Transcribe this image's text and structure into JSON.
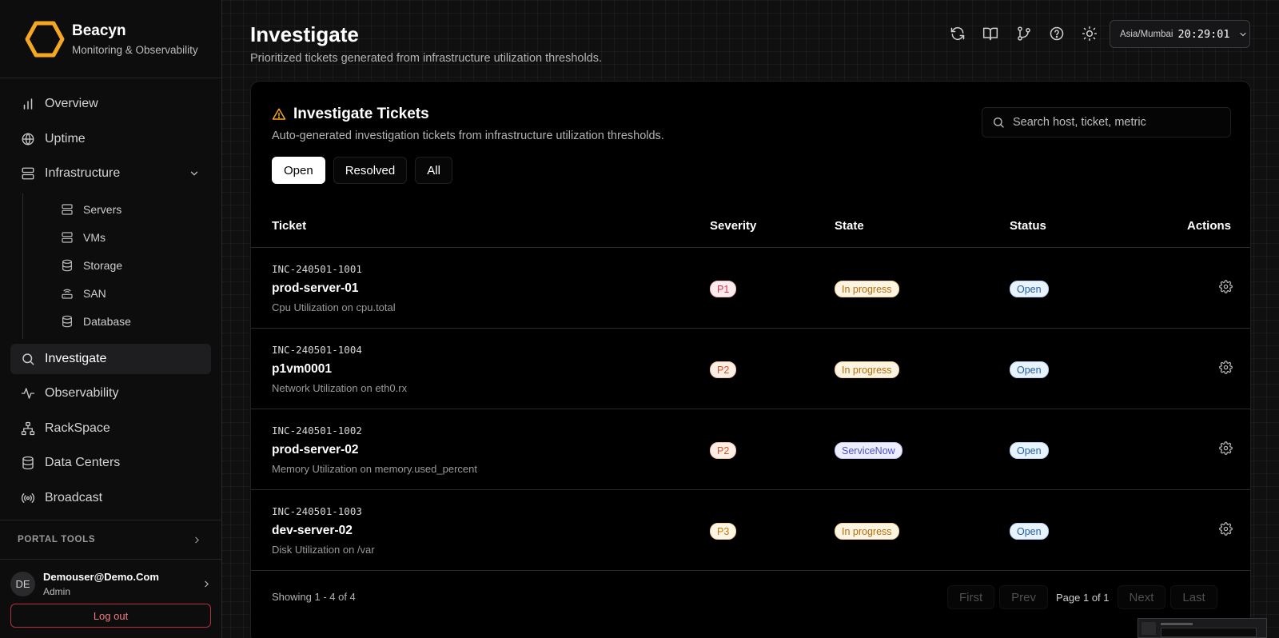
{
  "brand": {
    "name": "Beacyn",
    "tagline": "Monitoring & Observability",
    "logo_color": "#f5a623"
  },
  "sidebar": {
    "items": [
      {
        "label": "Overview",
        "icon": "bar-chart-icon"
      },
      {
        "label": "Uptime",
        "icon": "globe-icon"
      },
      {
        "label": "Infrastructure",
        "icon": "server-icon",
        "expanded": true
      }
    ],
    "infrastructure_children": [
      {
        "label": "Servers",
        "icon": "server-icon"
      },
      {
        "label": "VMs",
        "icon": "server-icon"
      },
      {
        "label": "Storage",
        "icon": "database-icon"
      },
      {
        "label": "SAN",
        "icon": "router-icon"
      },
      {
        "label": "Database",
        "icon": "database-icon"
      }
    ],
    "lower_items": [
      {
        "label": "Investigate",
        "icon": "search-icon",
        "active": true
      },
      {
        "label": "Observability",
        "icon": "activity-icon"
      },
      {
        "label": "RackSpace",
        "icon": "network-icon"
      },
      {
        "label": "Data Centers",
        "icon": "database-icon"
      },
      {
        "label": "Broadcast",
        "icon": "broadcast-icon"
      }
    ],
    "portal_tools": "PORTAL TOOLS",
    "user": {
      "initials": "DE",
      "email": "Demouser@Demo.Com",
      "role": "Admin"
    },
    "logout": "Log out"
  },
  "header": {
    "title": "Investigate",
    "subtitle": "Prioritized tickets generated from infrastructure utilization thresholds.",
    "toolbar_icons": [
      "refresh-icon",
      "book-icon",
      "git-branch-icon",
      "help-icon",
      "sun-icon"
    ],
    "timezone": "Asia/Mumbai",
    "time": "20:29:01"
  },
  "card": {
    "title": "Investigate Tickets",
    "subtitle": "Auto-generated investigation tickets from infrastructure utilization thresholds.",
    "search_placeholder": "Search host, ticket, metric",
    "filters": [
      {
        "label": "Open",
        "active": true
      },
      {
        "label": "Resolved",
        "active": false
      },
      {
        "label": "All",
        "active": false
      }
    ],
    "columns": {
      "ticket": "Ticket",
      "severity": "Severity",
      "state": "State",
      "status": "Status",
      "actions": "Actions"
    },
    "rows": [
      {
        "id": "INC-240501-1001",
        "host": "prod-server-01",
        "metric": "Cpu Utilization on cpu.total",
        "severity": "P1",
        "state": "In progress",
        "status": "Open"
      },
      {
        "id": "INC-240501-1004",
        "host": "p1vm0001",
        "metric": "Network Utilization on eth0.rx",
        "severity": "P2",
        "state": "In progress",
        "status": "Open"
      },
      {
        "id": "INC-240501-1002",
        "host": "prod-server-02",
        "metric": "Memory Utilization on memory.used_percent",
        "severity": "P2",
        "state": "ServiceNow",
        "status": "Open"
      },
      {
        "id": "INC-240501-1003",
        "host": "dev-server-02",
        "metric": "Disk Utilization on /var",
        "severity": "P3",
        "state": "In progress",
        "status": "Open"
      }
    ],
    "footer": {
      "showing": "Showing 1 - 4 of 4",
      "first": "First",
      "prev": "Prev",
      "page": "Page 1 of 1",
      "next": "Next",
      "last": "Last"
    }
  }
}
